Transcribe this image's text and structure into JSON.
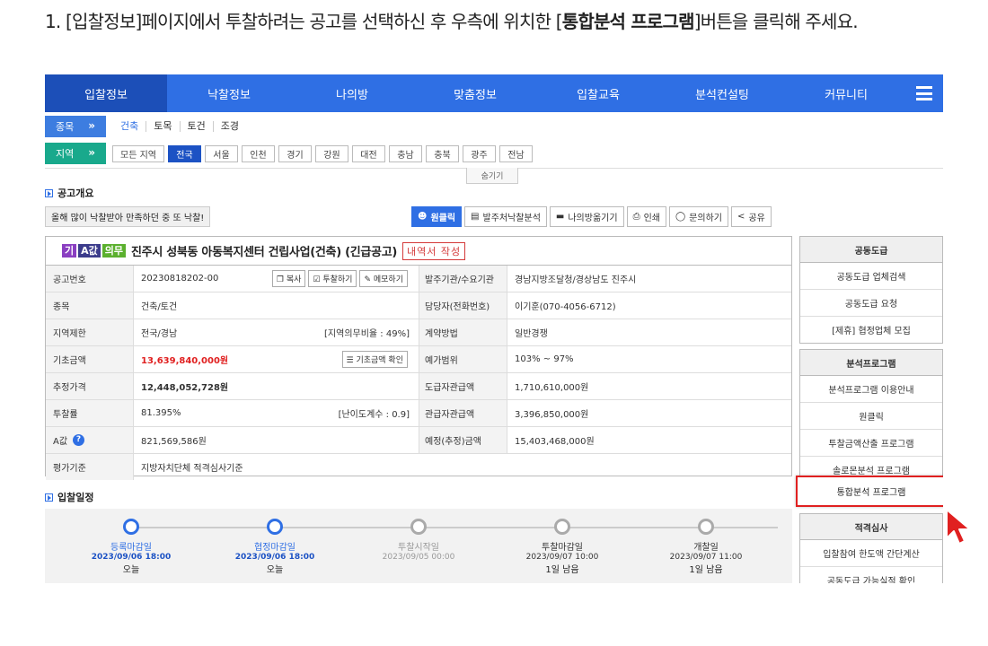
{
  "instruction": {
    "prefix": "1. [입찰정보]페이지에서 투찰하려는 공고를 선택하신 후 우측에 위치한 [",
    "bold": "통합분석 프로그램",
    "suffix": "]버튼을 클릭해 주세요."
  },
  "nav": {
    "items": [
      "입찰정보",
      "낙찰정보",
      "나의방",
      "맞춤정보",
      "입찰교육",
      "분석컨설팅",
      "커뮤니티"
    ],
    "active_index": 0
  },
  "filters": {
    "category_label": "종목",
    "categories": [
      "건축",
      "토목",
      "토건",
      "조경"
    ],
    "selected_category": "건축",
    "region_label": "지역",
    "regions": [
      "모든 지역",
      "전국",
      "서울",
      "인천",
      "경기",
      "강원",
      "대전",
      "충남",
      "충북",
      "광주",
      "전남"
    ],
    "selected_region": "전국",
    "hide_label": "숨기기"
  },
  "overview": {
    "section_title": "공고개요",
    "promo_text": "올해 많이 낙찰받아 만족하던 중 또 낙찰!",
    "toolbar": [
      "원클릭",
      "발주처낙찰분석",
      "나의방옮기기",
      "인쇄",
      "문의하기",
      "공유"
    ]
  },
  "notice": {
    "badges": [
      "기",
      "A값",
      "의무"
    ],
    "title": "진주시 성북동 아동복지센터 건립사업(건축) (긴급공고)",
    "write_label": "내역서 작성",
    "rows": [
      {
        "label": "공고번호",
        "value": "20230818202-00",
        "label2": "발주기관/수요기관",
        "value2": "경남지방조달청/경상남도 진주시"
      },
      {
        "label": "종목",
        "value": "건축/토건",
        "label2": "담당자(전화번호)",
        "value2": "이기훈(070-4056-6712)"
      },
      {
        "label": "지역제한",
        "value": "전국/경남",
        "extra": "[지역의무비율 : 49%]",
        "label2": "계약방법",
        "value2": "일반경쟁"
      },
      {
        "label": "기초금액",
        "value": "13,639,840,000원",
        "label2": "예가범위",
        "value2": "103% ~ 97%"
      },
      {
        "label": "추정가격",
        "value": "12,448,052,728원",
        "label2": "도급자관급액",
        "value2": "1,710,610,000원"
      },
      {
        "label": "투찰률",
        "value": "81.395%",
        "extra": "[난이도계수 : 0.9]",
        "label2": "관급자관급액",
        "value2": "3,396,850,000원"
      },
      {
        "label": "A값",
        "value": "821,569,586원",
        "label2": "예정(추정)금액",
        "value2": "15,403,468,000원"
      },
      {
        "label": "평가기준",
        "value": "지방자치단체 적격심사기준"
      }
    ],
    "row_buttons": [
      "복사",
      "투찰하기",
      "메모하기"
    ],
    "base_check_label": "기초금액 확인"
  },
  "side": {
    "group1": {
      "head": "공동도급",
      "items": [
        "공동도급 업체검색",
        "공동도급 요청",
        "[제휴] 협정업체 모집"
      ]
    },
    "group2": {
      "head": "분석프로그램",
      "items": [
        "분석프로그램 이용안내",
        "원클릭",
        "투찰금액산출 프로그램",
        "솔로몬분석 프로그램"
      ]
    },
    "highlight_item": "통합분석 프로그램",
    "group3": {
      "head": "적격심사",
      "items": [
        "입찰참여 한도액 간단계산",
        "공동도급 가능실적 확인"
      ]
    }
  },
  "schedule": {
    "section_title": "입찰일정",
    "steps": [
      {
        "name": "등록마감일",
        "date": "2023/09/06 18:00",
        "status": "오늘",
        "state": "done"
      },
      {
        "name": "협정마감일",
        "date": "2023/09/06 18:00",
        "status": "오늘",
        "state": "done"
      },
      {
        "name": "투찰시작일",
        "date": "2023/09/05 00:00",
        "status": "",
        "state": "past"
      },
      {
        "name": "투찰마감일",
        "date": "2023/09/07 10:00",
        "status": "1일 남음",
        "state": "future"
      },
      {
        "name": "개찰일",
        "date": "2023/09/07 11:00",
        "status": "1일 남음",
        "state": "future"
      }
    ]
  },
  "colors": {
    "primary": "#2f6fe4",
    "nav_active": "#1c4fb8",
    "highlight": "#e02020",
    "cursor": "#e02020"
  }
}
